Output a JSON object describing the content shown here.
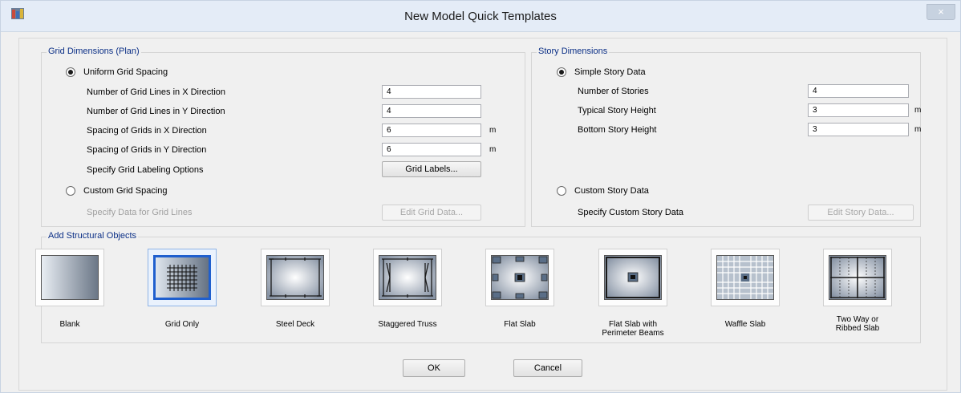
{
  "window": {
    "title": "New Model Quick Templates",
    "close_glyph": "×"
  },
  "grid_dimensions": {
    "title": "Grid Dimensions (Plan)",
    "uniform_label": "Uniform Grid Spacing",
    "uniform_selected": true,
    "fields": [
      {
        "label": "Number of Grid Lines in X Direction",
        "value": "4",
        "unit": ""
      },
      {
        "label": "Number of Grid Lines in Y Direction",
        "value": "4",
        "unit": ""
      },
      {
        "label": "Spacing of Grids in X Direction",
        "value": "6",
        "unit": "m"
      },
      {
        "label": "Spacing of Grids in Y Direction",
        "value": "6",
        "unit": "m"
      }
    ],
    "labeling_label": "Specify Grid Labeling Options",
    "grid_labels_button": "Grid Labels...",
    "custom_label": "Custom Grid Spacing",
    "custom_data_label": "Specify Data for Grid Lines",
    "edit_grid_button": "Edit Grid Data..."
  },
  "story_dimensions": {
    "title": "Story Dimensions",
    "simple_label": "Simple Story Data",
    "simple_selected": true,
    "fields": [
      {
        "label": "Number of Stories",
        "value": "4",
        "unit": ""
      },
      {
        "label": "Typical Story Height",
        "value": "3",
        "unit": "m"
      },
      {
        "label": "Bottom Story Height",
        "value": "3",
        "unit": "m"
      }
    ],
    "custom_label": "Custom Story Data",
    "custom_data_label": "Specify Custom Story Data",
    "edit_story_button": "Edit Story Data..."
  },
  "structural_objects": {
    "title": "Add Structural Objects",
    "selected": "Grid Only",
    "items": [
      {
        "label": "Blank",
        "icon": "blank-template-icon"
      },
      {
        "label": "Grid Only",
        "icon": "grid-only-template-icon"
      },
      {
        "label": "Steel Deck",
        "icon": "steel-deck-template-icon"
      },
      {
        "label": "Staggered Truss",
        "icon": "staggered-truss-template-icon"
      },
      {
        "label": "Flat Slab",
        "icon": "flat-slab-template-icon"
      },
      {
        "label": "Flat Slab with Perimeter Beams",
        "icon": "flat-slab-perimeter-beams-template-icon"
      },
      {
        "label": "Waffle Slab",
        "icon": "waffle-slab-template-icon"
      },
      {
        "label": "Two Way or Ribbed Slab",
        "icon": "two-way-ribbed-slab-template-icon"
      }
    ]
  },
  "buttons": {
    "ok": "OK",
    "cancel": "Cancel"
  },
  "colors": {
    "group_title": "#0b2f86",
    "selection_border": "#1f5fce",
    "titlebar": "#e4ecf7"
  }
}
